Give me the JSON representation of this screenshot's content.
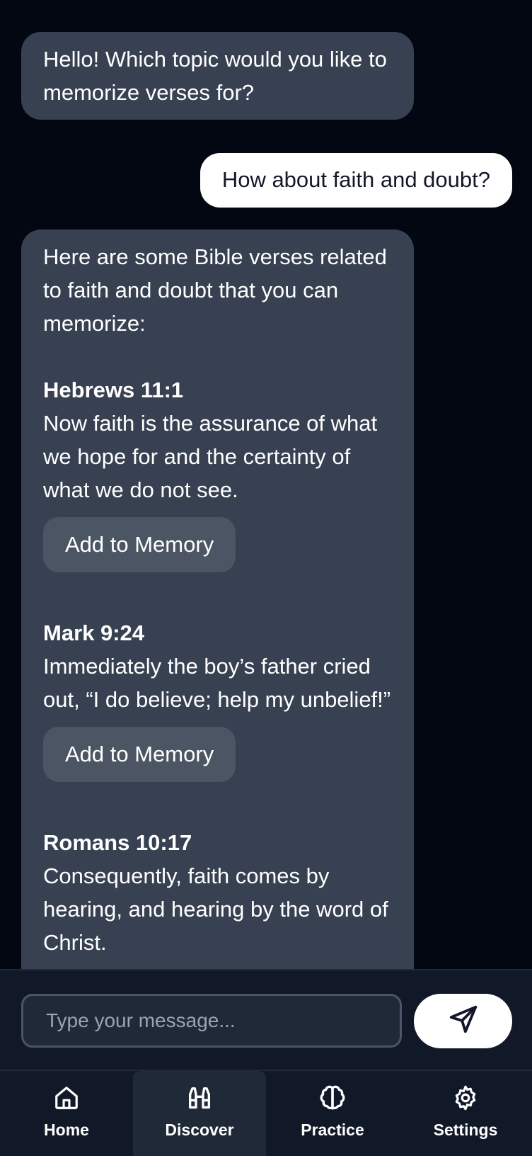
{
  "chat": {
    "greeting": "Hello! Which topic would you like to memorize verses for?",
    "user_message": "How about faith and doubt?",
    "answer_intro": "Here are some Bible verses related to faith and doubt that you can memorize:",
    "verses": [
      {
        "reference": "Hebrews 11:1",
        "text": "Now faith is the assurance of what we hope for and the certainty of what we do not see.",
        "button": "Add to Memory"
      },
      {
        "reference": "Mark 9:24",
        "text": "Immediately the boy’s father cried out, “I do believe; help my unbelief!”",
        "button": "Add to Memory"
      },
      {
        "reference": "Romans 10:17",
        "text": "Consequently, faith comes by hearing, and hearing by the word of Christ."
      }
    ]
  },
  "composer": {
    "placeholder": "Type your message...",
    "send_icon": "send-icon"
  },
  "nav": {
    "items": [
      {
        "label": "Home",
        "icon": "home-icon"
      },
      {
        "label": "Discover",
        "icon": "binoculars-icon"
      },
      {
        "label": "Practice",
        "icon": "brain-icon"
      },
      {
        "label": "Settings",
        "icon": "gear-icon"
      }
    ],
    "active": "Discover"
  },
  "colors": {
    "background": "#030712",
    "bot_bubble": "#374151",
    "user_bubble": "#ffffff",
    "button": "#4b5563",
    "nav": "#111827"
  }
}
